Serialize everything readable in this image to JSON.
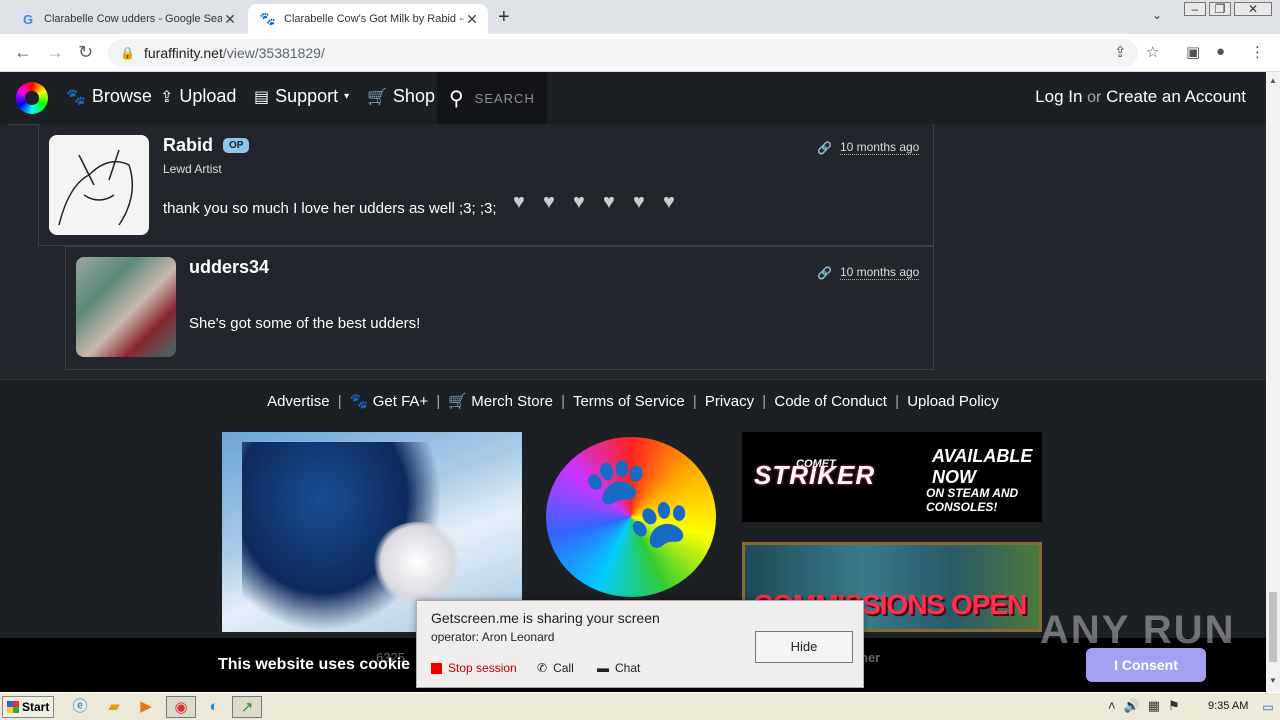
{
  "browser": {
    "tabs": [
      {
        "title": "Clarabelle Cow udders - Google Sear",
        "favicon": "G",
        "active": false
      },
      {
        "title": "Clarabelle Cow's Got Milk by Rabid --",
        "favicon": "paw-icon",
        "active": true
      }
    ],
    "new_tab": "+",
    "url_domain": "furaffinity.net",
    "url_path": "/view/35381829/"
  },
  "fa_nav": {
    "links": [
      {
        "label": "Browse",
        "icon": "paw-icon"
      },
      {
        "label": "Upload",
        "icon": "upload-icon"
      },
      {
        "label": "Support",
        "icon": "support-icon"
      },
      {
        "label": "Shop",
        "icon": "cart-icon"
      }
    ],
    "search_label": "SEARCH",
    "login": "Log In",
    "or": "or",
    "create": "Create an Account"
  },
  "comments": [
    {
      "name": "Rabid",
      "badge": "OP",
      "title": "Lewd Artist",
      "text": "thank you so much I love her udders as well ;3; ;3;",
      "time": "10 months ago",
      "hearts": 6
    },
    {
      "name": "udders34",
      "title": "",
      "text": "She's got some of the best udders!",
      "time": "10 months ago"
    }
  ],
  "footer": {
    "links": [
      "Advertise",
      "Get FA+",
      "Merch Store",
      "Terms of Service",
      "Privacy",
      "Code of Conduct",
      "Upload Policy"
    ],
    "ads": {
      "comet_top": "COMET",
      "comet_main": "STRIKER",
      "available": "AVAILABLE NOW",
      "steam": "ON STEAM AND CONSOLES!",
      "commissions": "COMMISSIONS OPEN"
    }
  },
  "cookie": {
    "text": "This website uses cookie",
    "behind_left": "6325",
    "behind_right": "her",
    "consent": "I Consent"
  },
  "popup": {
    "message": "Getscreen.me is sharing your screen",
    "operator": "operator: Aron Leonard",
    "hide": "Hide",
    "stop": "Stop session",
    "call": "Call",
    "chat": "Chat"
  },
  "watermark": "ANY RUN",
  "taskbar": {
    "start": "Start",
    "time": "9:35 AM"
  }
}
